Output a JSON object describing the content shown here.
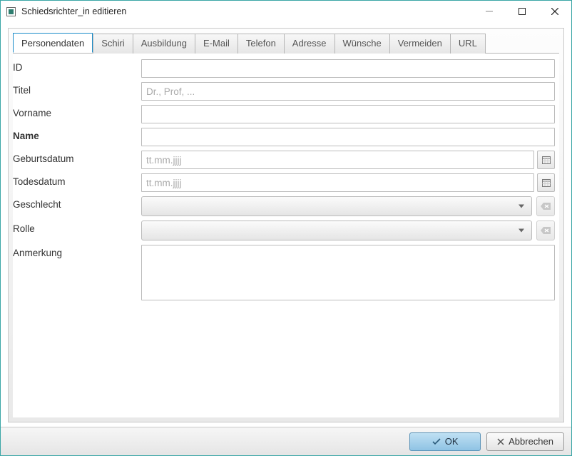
{
  "window": {
    "title": "Schiedsrichter_in editieren"
  },
  "tabs": [
    {
      "label": "Personendaten",
      "active": true
    },
    {
      "label": "Schiri"
    },
    {
      "label": "Ausbildung"
    },
    {
      "label": "E-Mail"
    },
    {
      "label": "Telefon"
    },
    {
      "label": "Adresse"
    },
    {
      "label": "Wünsche"
    },
    {
      "label": "Vermeiden"
    },
    {
      "label": "URL"
    }
  ],
  "form": {
    "id": {
      "label": "ID",
      "value": "",
      "placeholder": ""
    },
    "titel": {
      "label": "Titel",
      "value": "",
      "placeholder": "Dr., Prof, ..."
    },
    "vorname": {
      "label": "Vorname",
      "value": "",
      "placeholder": ""
    },
    "name": {
      "label": "Name",
      "value": "",
      "placeholder": "",
      "required": true
    },
    "geburtsdatum": {
      "label": "Geburtsdatum",
      "value": "",
      "placeholder": "tt.mm.jjjj"
    },
    "todesdatum": {
      "label": "Todesdatum",
      "value": "",
      "placeholder": "tt.mm.jjjj"
    },
    "geschlecht": {
      "label": "Geschlecht",
      "value": ""
    },
    "rolle": {
      "label": "Rolle",
      "value": ""
    },
    "anmerkung": {
      "label": "Anmerkung",
      "value": ""
    }
  },
  "footer": {
    "ok": "OK",
    "cancel": "Abbrechen"
  }
}
